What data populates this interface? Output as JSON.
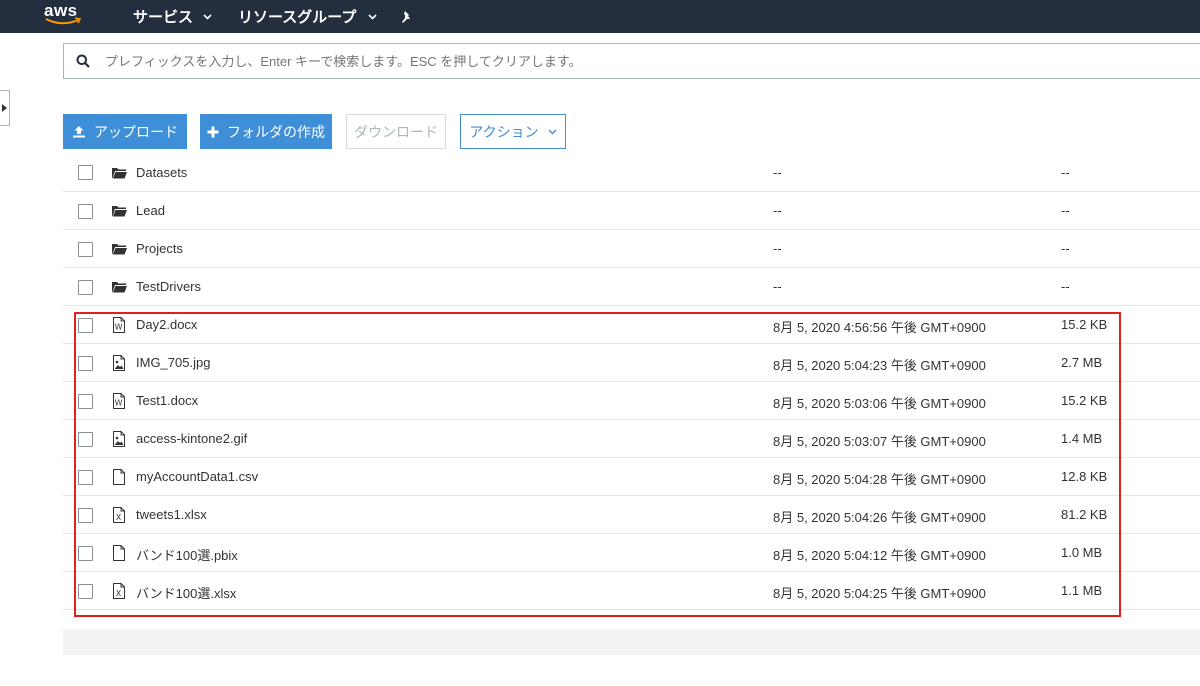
{
  "header": {
    "logo_text": "aws",
    "services_label": "サービス",
    "resource_groups_label": "リソースグループ"
  },
  "search": {
    "placeholder": "プレフィックスを入力し、Enter キーで検索します。ESC を押してクリアします。"
  },
  "toolbar": {
    "upload_label": "アップロード",
    "create_folder_label": "フォルダの作成",
    "download_label": "ダウンロード",
    "actions_label": "アクション"
  },
  "table": {
    "rows": [
      {
        "name": "Datasets",
        "type": "folder",
        "date": "--",
        "size": "--"
      },
      {
        "name": "Lead",
        "type": "folder",
        "date": "--",
        "size": "--"
      },
      {
        "name": "Projects",
        "type": "folder",
        "date": "--",
        "size": "--"
      },
      {
        "name": "TestDrivers",
        "type": "folder",
        "date": "--",
        "size": "--"
      },
      {
        "name": "Day2.docx",
        "type": "word",
        "date": "8月 5, 2020 4:56:56 午後 GMT+0900",
        "size": "15.2 KB"
      },
      {
        "name": "IMG_705.jpg",
        "type": "image",
        "date": "8月 5, 2020 5:04:23 午後 GMT+0900",
        "size": "2.7 MB"
      },
      {
        "name": "Test1.docx",
        "type": "word",
        "date": "8月 5, 2020 5:03:06 午後 GMT+0900",
        "size": "15.2 KB"
      },
      {
        "name": "access-kintone2.gif",
        "type": "image",
        "date": "8月 5, 2020 5:03:07 午後 GMT+0900",
        "size": "1.4 MB"
      },
      {
        "name": "myAccountData1.csv",
        "type": "file",
        "date": "8月 5, 2020 5:04:28 午後 GMT+0900",
        "size": "12.8 KB"
      },
      {
        "name": "tweets1.xlsx",
        "type": "excel",
        "date": "8月 5, 2020 5:04:26 午後 GMT+0900",
        "size": "81.2 KB"
      },
      {
        "name": "バンド100選.pbix",
        "type": "file",
        "date": "8月 5, 2020 5:04:12 午後 GMT+0900",
        "size": "1.0 MB"
      },
      {
        "name": "バンド100選.xlsx",
        "type": "excel",
        "date": "8月 5, 2020 5:04:25 午後 GMT+0900",
        "size": "1.1 MB"
      }
    ]
  },
  "colors": {
    "nav_bg": "#232f3e",
    "primary_button": "#3f8fd8",
    "highlight_border": "#e0201f"
  }
}
